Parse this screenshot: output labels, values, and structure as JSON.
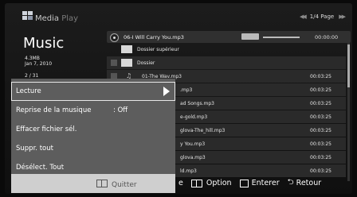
{
  "header": {
    "brand_main": "Media",
    "brand_sub": " Play",
    "page": "1/4 Page"
  },
  "section": {
    "title": "Music",
    "size": "4.3MB",
    "date": "Jan 7, 2010",
    "count": "2 / 31"
  },
  "now_playing": {
    "title": "06-I Will Carry You.mp3",
    "time": "00:00:00",
    "progress": 0.0
  },
  "list": [
    {
      "type": "folder",
      "text": "Dossier supérieur",
      "time": ""
    },
    {
      "type": "folder",
      "text": "Dossier",
      "time": ""
    },
    {
      "type": "file",
      "text": "01-The Wav.mp3",
      "time": "00:03:25"
    },
    {
      "type": "file",
      "text": ".mp3",
      "time": "00:03:25"
    },
    {
      "type": "file",
      "text": "ad Songs.mp3",
      "time": "00:03:25"
    },
    {
      "type": "file",
      "text": "e-gold.mp3",
      "time": "00:03:25"
    },
    {
      "type": "file",
      "text": "glova-The_hill.mp3",
      "time": "00:03:25"
    },
    {
      "type": "file",
      "text": "y You.mp3",
      "time": "00:03:25"
    },
    {
      "type": "file",
      "text": "glova.mp3",
      "time": "00:03:25"
    },
    {
      "type": "file",
      "text": "ld.mp3",
      "time": "00:03:25"
    }
  ],
  "menu": {
    "items": [
      {
        "label": "Lecture",
        "value": ""
      },
      {
        "label": "Reprise de la musique",
        "value": ": Off"
      },
      {
        "label": "Effacer fichier sél.",
        "value": ""
      },
      {
        "label": "Suppr. tout",
        "value": ""
      },
      {
        "label": "Désélect. Tout",
        "value": ""
      }
    ],
    "quit": "Quitter"
  },
  "footer": {
    "partial": "e",
    "option": "Option",
    "enter": "Enterer",
    "back": "Retour"
  }
}
